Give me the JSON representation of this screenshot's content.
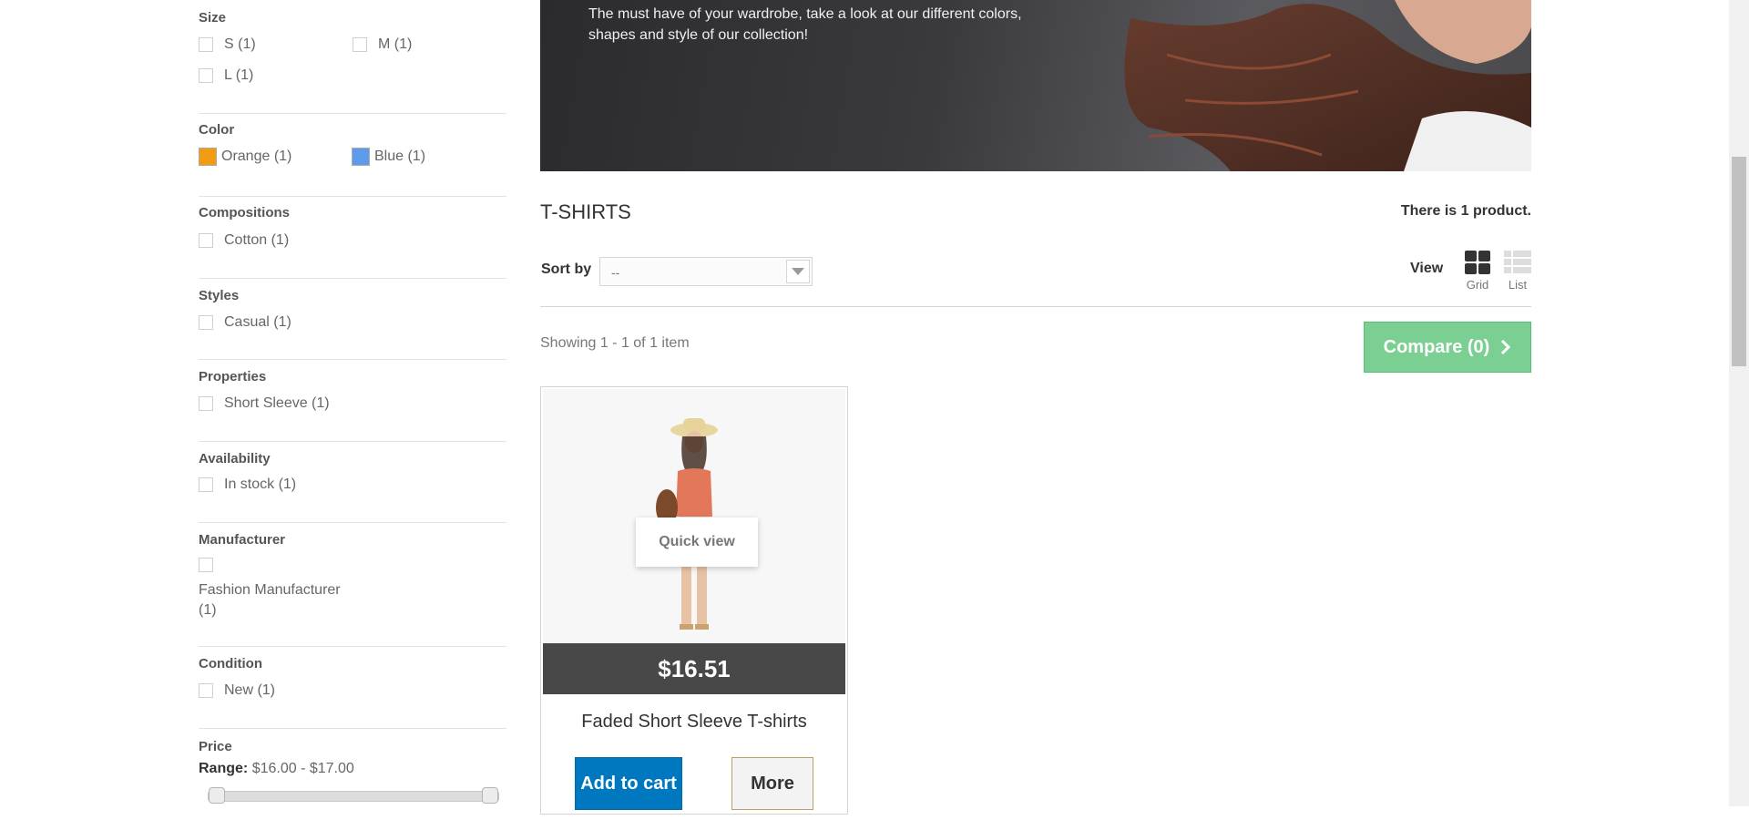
{
  "filters": {
    "size": {
      "title": "Size",
      "options": [
        "S (1)",
        "M (1)",
        "L (1)"
      ]
    },
    "color": {
      "title": "Color",
      "options": [
        {
          "label": "Orange (1)",
          "color": "#f39c11"
        },
        {
          "label": "Blue (1)",
          "color": "#5d9cec"
        }
      ]
    },
    "compositions": {
      "title": "Compositions",
      "options": [
        "Cotton (1)"
      ]
    },
    "styles": {
      "title": "Styles",
      "options": [
        "Casual (1)"
      ]
    },
    "properties": {
      "title": "Properties",
      "options": [
        "Short Sleeve (1)"
      ]
    },
    "availability": {
      "title": "Availability",
      "options": [
        "In stock (1)"
      ]
    },
    "manufacturer": {
      "title": "Manufacturer",
      "options": [
        "Fashion Manufacturer",
        "(1)"
      ]
    },
    "condition": {
      "title": "Condition",
      "options": [
        "New (1)"
      ]
    },
    "price": {
      "title": "Price",
      "range_label": "Range:",
      "range_value": "$16.00 - $17.00",
      "min_fraction": 0,
      "max_fraction": 1
    }
  },
  "banner": {
    "text": "The must have of your wardrobe, take a look at our different colors, shapes and style of our collection!"
  },
  "category": {
    "title": "T-SHIRTS",
    "count_prefix": "There is ",
    "count_value": "1",
    "count_suffix": " product."
  },
  "toolbar": {
    "sort_label": "Sort by",
    "sort_value": "--",
    "view_label": "View",
    "grid_label": "Grid",
    "list_label": "List",
    "showing": "Showing 1 - 1 of 1 item",
    "compare_label": "Compare (0)"
  },
  "product": {
    "quick_view": "Quick view",
    "price": "$16.51",
    "name": "Faded Short Sleeve T-shirts",
    "add_to_cart": "Add to cart",
    "more": "More"
  },
  "colors": {
    "compare_green": "#7ccf92",
    "cart_blue": "#0078c0",
    "price_bar": "#484848"
  }
}
